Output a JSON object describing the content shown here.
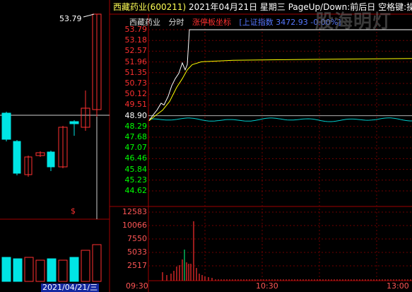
{
  "header": {
    "stock_title": "西藏药业(600211)",
    "date_text": "2021年04月21日 星期三 PageUp/Down:前后日 空格键:操",
    "name": "西藏药业",
    "mode": "分时",
    "limit_label": "涨停板坐标",
    "index_label": "[上证指数 3472.93 -0.00%]",
    "watermark": "股海明灯"
  },
  "kline": {
    "high_label": "53.79",
    "date_bar": "2021/04/21/三",
    "marker": "$"
  },
  "price_axis": {
    "up_labels": [
      "53.79",
      "53.18",
      "52.57",
      "51.96",
      "51.35",
      "50.73",
      "50.12",
      "49.51"
    ],
    "base_label": "48.90",
    "down_labels": [
      "48.29",
      "47.68",
      "47.07",
      "46.46",
      "45.84",
      "45.23",
      "44.62"
    ]
  },
  "volume_axis": [
    "12583",
    "10066",
    "7550",
    "5033",
    "2517"
  ],
  "time_axis": [
    "09:30",
    "10:30",
    "13:00"
  ],
  "colors": {
    "up": "#ff3030",
    "down": "#00e5e5",
    "price_line": "#ffffff",
    "avg_line": "#ffff00",
    "index_line": "#00cccc",
    "volume": "#ff3030",
    "grid": "#800000",
    "base_text": "#ffffff",
    "down_text": "#00ff00"
  }
}
